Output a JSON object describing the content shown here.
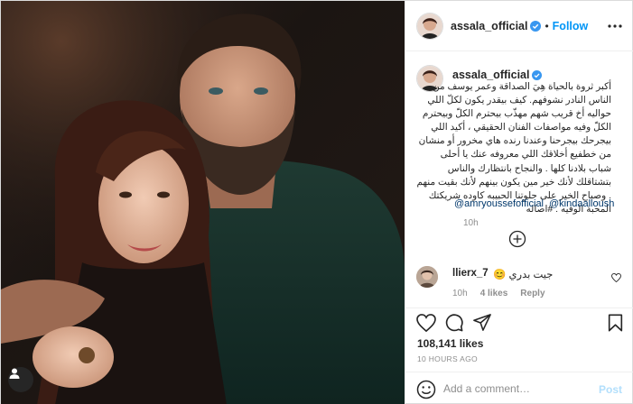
{
  "header": {
    "username": "assala_official",
    "separator": "•",
    "follow_label": "Follow"
  },
  "caption": {
    "username": "assala_official",
    "text": "أكبر ثروة بالحياة هِيَ الصداقة وعمر يوسف من الناس النادر نشوفهم. كيف بيقدر يكون لكلّ اللي حواليه أخ قريب شهم مهذّب بيحترم الكلّ وبيحترم الكلّ وفيه مواصفات الفنان الحقيقي ، أكيد اللي بيجرحك بيجرحنا وعندنا رنده هاي مخرور أو منشان من خطفيع أخلاقك اللي معروفه عنك يا أحلى شباب بلادنا كلها . والنجاح بانتظارك والناس بتشتاقلك لأنك خير مين يكون بينهم لأنك بقيت منهم . وصباح الخير على حلوتنا الحبيبه كاوده شريكتك المحبة الوفيه . #اصاله",
    "mentions": [
      "@amryoussefofficial",
      "@kindaalloush"
    ],
    "time": "10h"
  },
  "comment": {
    "username": "llierx_7",
    "text": "😊 جيت بدري",
    "time": "10h",
    "likes": "4 likes",
    "reply_label": "Reply"
  },
  "post": {
    "likes": "108,141 likes",
    "timestamp": "10 HOURS AGO"
  },
  "composer": {
    "placeholder": "Add a comment…",
    "post_label": "Post"
  },
  "icons": {
    "verified": "verified-badge-icon",
    "more": "more-options-icon",
    "load_more": "plus-circle-icon",
    "like": "heart-icon",
    "comment": "comment-bubble-icon",
    "share": "paper-plane-icon",
    "save": "bookmark-icon",
    "emoji": "smiley-icon",
    "tag": "user-tag-icon"
  },
  "colors": {
    "accent": "#0095f6",
    "text": "#262626",
    "muted": "#8e8e8e",
    "link": "#00376b",
    "post_disabled": "#b2dffc"
  }
}
